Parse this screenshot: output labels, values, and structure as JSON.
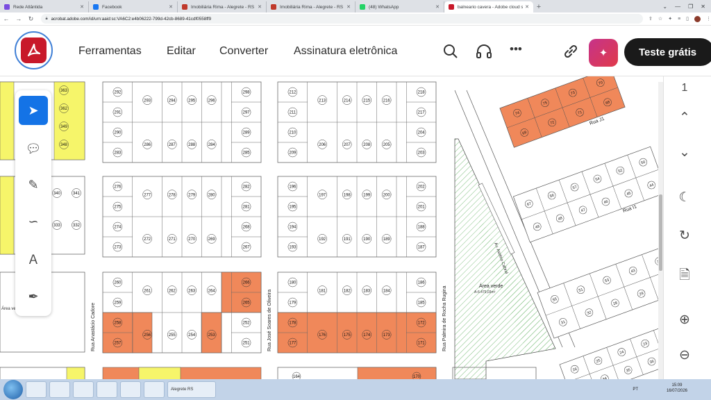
{
  "browser": {
    "tabs": [
      {
        "title": "Rede Atlântida",
        "color": "#7b4de0",
        "active": false
      },
      {
        "title": "Facebook",
        "color": "#1877f2",
        "active": false
      },
      {
        "title": "Imobiliária Rima - Alegrete - RS",
        "color": "#c0392b",
        "active": false
      },
      {
        "title": "Imobiliária Rima - Alegrete - RS",
        "color": "#c0392b",
        "active": false
      },
      {
        "title": "(48) WhatsApp",
        "color": "#25d366",
        "active": false
      },
      {
        "title": "balneario cavera - Adobe cloud s",
        "color": "#c8192a",
        "active": true
      }
    ],
    "url": "acrobat.adobe.com/id/urn:aaid:sc:VA6C2:e4b06222-799d-42cb-8689-41cdf0558ff9"
  },
  "acrobat": {
    "menu": [
      "Ferramentas",
      "Editar",
      "Converter",
      "Assinatura eletrônica"
    ],
    "trial_button": "Teste grátis",
    "page_number": "1"
  },
  "document": {
    "blocks": [
      {
        "lots": [
          "292",
          "293",
          "294",
          "295",
          "296",
          "298",
          "291",
          "297",
          "290",
          "286",
          "287",
          "288",
          "284",
          "289",
          "283",
          "285"
        ]
      },
      {
        "lots": [
          "212",
          "213",
          "214",
          "215",
          "216",
          "218",
          "211",
          "217",
          "210",
          "206",
          "207",
          "208",
          "205",
          "204",
          "209",
          "203"
        ]
      },
      {
        "lots": [
          "276",
          "277",
          "278",
          "279",
          "280",
          "282",
          "275",
          "281",
          "274",
          "272",
          "271",
          "270",
          "269",
          "268",
          "273",
          "267"
        ]
      },
      {
        "lots": [
          "196",
          "197",
          "198",
          "199",
          "200",
          "202",
          "195",
          "201",
          "194",
          "192",
          "191",
          "190",
          "189",
          "188",
          "193",
          "187"
        ]
      },
      {
        "lots": [
          "260",
          "261",
          "262",
          "263",
          "264",
          "266",
          "259",
          "265",
          "258",
          "256",
          "255",
          "254",
          "253",
          "252",
          "257",
          "251"
        ]
      },
      {
        "lots": [
          "180",
          "181",
          "182",
          "183",
          "184",
          "186",
          "179",
          "185",
          "178",
          "176",
          "175",
          "174",
          "173",
          "172",
          "177",
          "171"
        ]
      }
    ],
    "left_strip_lots": [
      "363",
      "362",
      "349",
      "348",
      "340",
      "341",
      "333",
      "332"
    ],
    "street_labels": [
      "Rua Anastácio Cadore",
      "Rua José Soares de Oliveira",
      "Rua Palmira de Rocha Rugina",
      "Av. Astério Cabral",
      "Rua J1",
      "Rua I1"
    ],
    "green_area_label": "Área verde",
    "green_area_size": "A-6.479,03m²",
    "left_green_label": "Área ve",
    "right_lots": [
      "74",
      "75",
      "73",
      "70",
      "69",
      "72",
      "71",
      "68",
      "67",
      "56",
      "57",
      "54",
      "52",
      "50",
      "49",
      "48",
      "47",
      "46",
      "45",
      "44",
      "55",
      "51",
      "53",
      "43",
      "30",
      "31",
      "32",
      "28",
      "29",
      "27",
      "26",
      "25",
      "24",
      "23",
      "22",
      "33",
      "34",
      "35",
      "36"
    ],
    "bottom_lots": [
      "164",
      "170",
      "141"
    ]
  },
  "taskbar": {
    "clock_time": "15:09",
    "clock_date": "16/07/2026",
    "language": "PT",
    "search_text": "Alegrete RS"
  },
  "colors": {
    "orange_lot": "#f0885a",
    "yellow_lot": "#f6f56a",
    "green_hatch": "#7fbf7f",
    "acrobat_red": "#c8192a"
  }
}
